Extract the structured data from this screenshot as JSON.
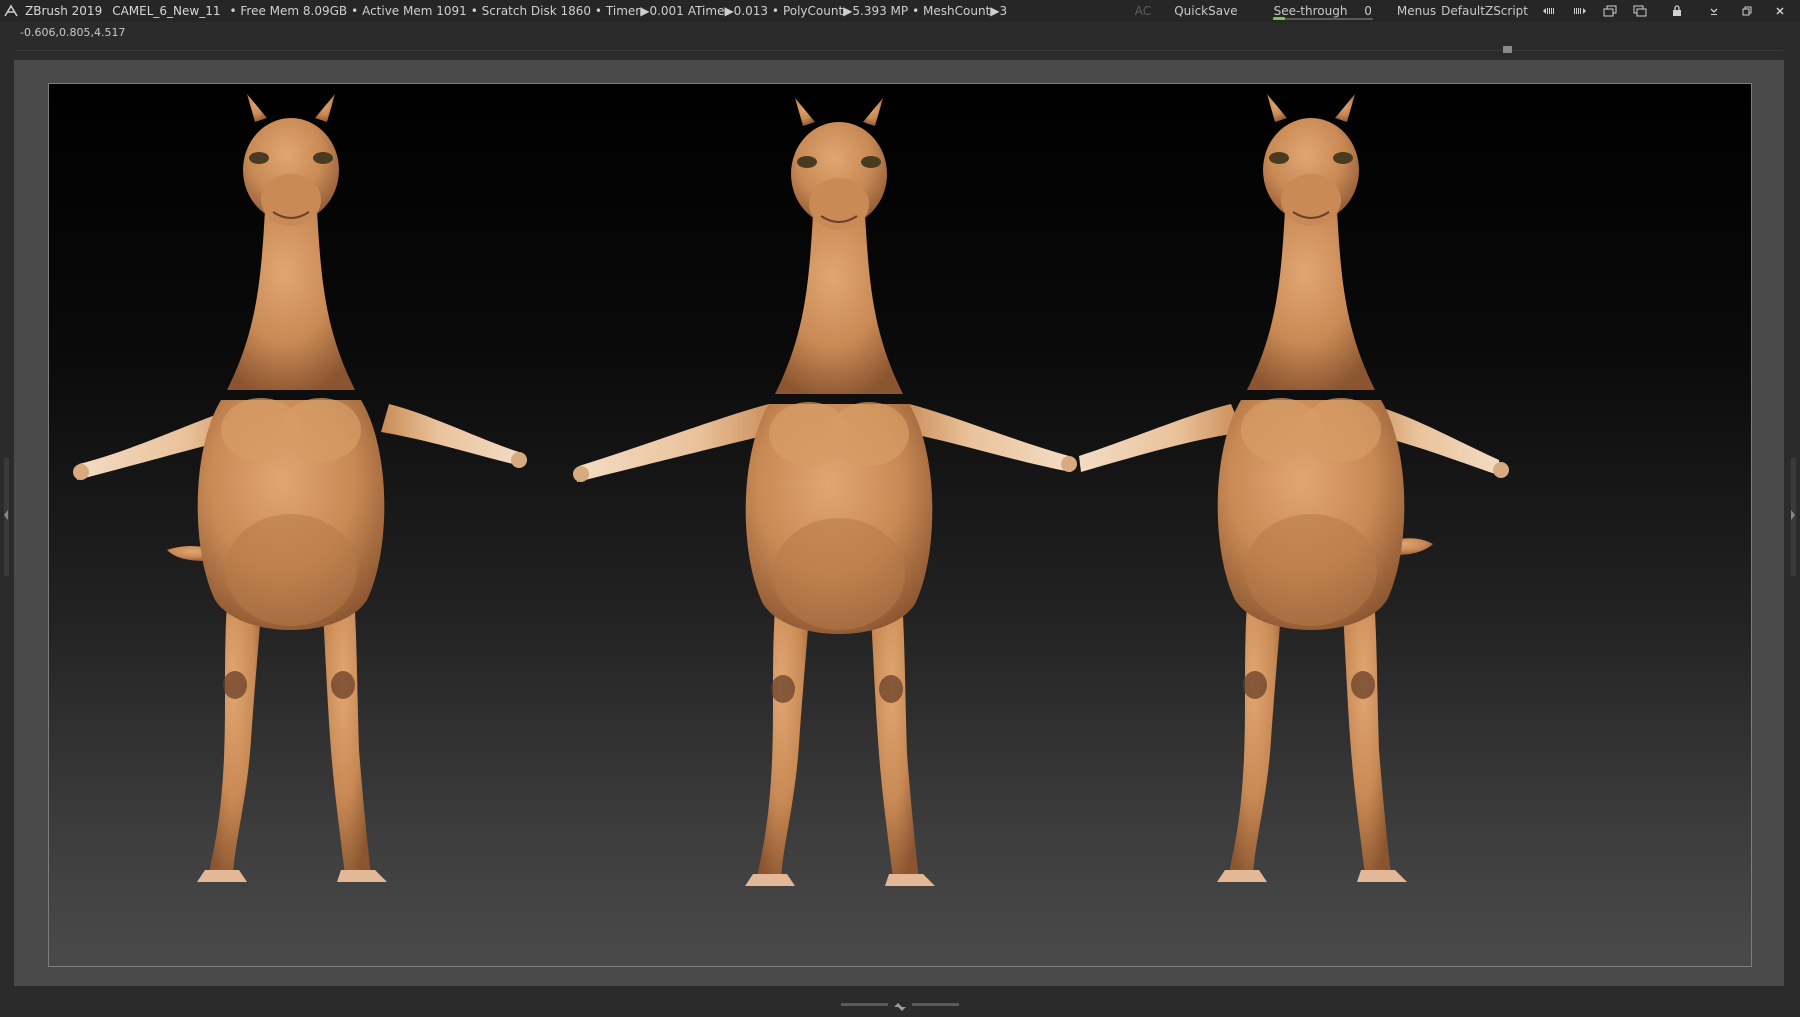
{
  "app": {
    "name": "ZBrush 2019",
    "document": "CAMEL_6_New_11"
  },
  "stats": {
    "free_mem": "• Free Mem 8.09GB",
    "active_mem": "• Active Mem 1091",
    "scratch_disk": "• Scratch Disk 1860 •",
    "timer": "Timer▶0.001",
    "atime": "ATime▶0.013 •",
    "polycount": "PolyCount▶5.393 MP",
    "meshcount": "• MeshCount▶3"
  },
  "toolbar_right": {
    "ac": "AC",
    "quicksave": "QuickSave",
    "see_through_label": "See-through",
    "see_through_value": "0",
    "menus": "Menus",
    "default_zscript": "DefaultZScript"
  },
  "coords": "-0.606,0.805,4.517",
  "colors": {
    "accent_green": "#7ac943",
    "camel_skin": "#c98a55",
    "camel_shadow": "#8a5530",
    "camel_highlight": "#e8b888"
  },
  "icons": [
    "zbrush-logo-icon",
    "layout-icon",
    "interface-icon",
    "copy-icon",
    "paste-icon",
    "lock-icon",
    "minimize-icon",
    "restore-icon",
    "close-icon"
  ]
}
